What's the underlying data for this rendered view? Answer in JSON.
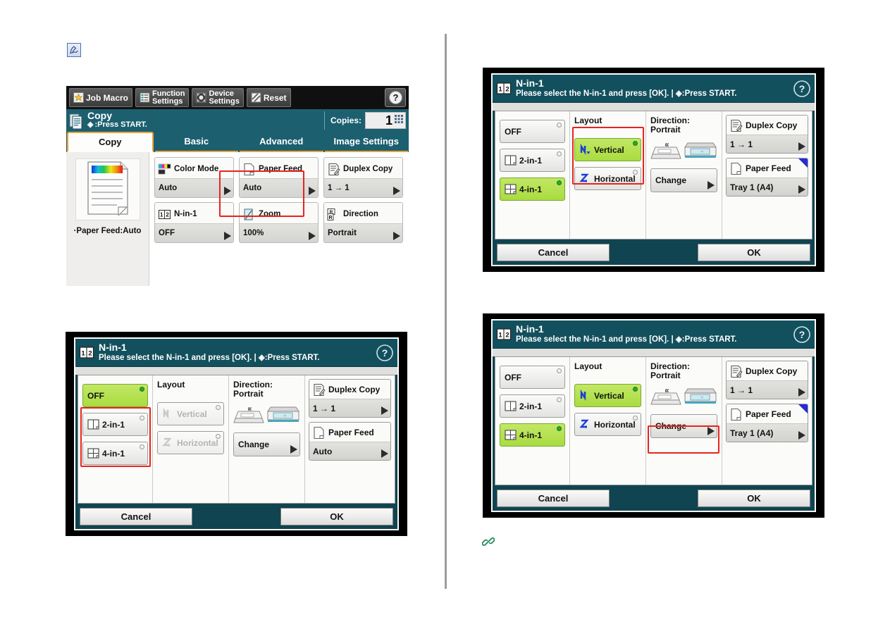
{
  "page": {
    "memo_icon": "memo-pen-icon",
    "link_icon": "link-chain-icon"
  },
  "console": {
    "toolbar": {
      "buttons": [
        {
          "label": "Job Macro",
          "icon": "star-macro-icon"
        },
        {
          "label_line1": "Function",
          "label_line2": "Settings",
          "icon": "list-settings-icon"
        },
        {
          "label_line1": "Device",
          "label_line2": "Settings",
          "icon": "device-settings-icon"
        },
        {
          "label": "Reset",
          "icon": "reset-slash-icon"
        }
      ],
      "help_icon": "help-question-icon"
    },
    "status": {
      "icon": "copy-document-icon",
      "title": "Copy",
      "subtitle": ":Press START.",
      "start_glyph": "◈",
      "copies_label": "Copies:",
      "copies_value": "1",
      "keypad_icon": "keypad-icon"
    },
    "tabs": [
      {
        "label": "Copy",
        "active": true
      },
      {
        "label": "Basic",
        "active": false
      },
      {
        "label": "Advanced",
        "active": false
      },
      {
        "label": "Image Settings",
        "active": false
      }
    ],
    "preview": {
      "icon": "color-page-preview-icon",
      "caption": "·Paper Feed:Auto"
    },
    "functions": [
      {
        "name": "Color Mode",
        "value": "Auto",
        "icon": "color-mode-icon",
        "highlighted": false
      },
      {
        "name": "Paper Feed",
        "value": "Auto",
        "icon": "paper-feed-icon",
        "highlighted": false
      },
      {
        "name": "Duplex Copy",
        "value": "1 → 1",
        "icon": "duplex-copy-icon",
        "highlighted": false
      },
      {
        "name": "N-in-1",
        "value": "OFF",
        "icon": "n-in-1-icon",
        "highlighted": true
      },
      {
        "name": "Zoom",
        "value": "100%",
        "icon": "zoom-icon",
        "highlighted": false
      },
      {
        "name": "Direction",
        "value": "Portrait",
        "icon": "direction-icon",
        "highlighted": false
      }
    ]
  },
  "dialog_common": {
    "icon": "n-in-1-icon",
    "title": "N-in-1",
    "instruction": "Please select the N-in-1 and press [OK]. | ◈:Press START.",
    "help_icon": "help-question-icon",
    "layout_heading": "Layout",
    "direction_heading_line1": "Direction:",
    "direction_heading_line2": "Portrait",
    "change_label": "Change",
    "cancel_label": "Cancel",
    "ok_label": "OK",
    "mode_options": [
      "OFF",
      "2-in-1",
      "4-in-1"
    ],
    "layout_options": [
      "Vertical",
      "Horizontal"
    ],
    "duplex": {
      "name": "Duplex Copy",
      "value": "1 → 1",
      "icon": "duplex-copy-icon"
    },
    "paper_feed_name": "Paper Feed",
    "paper_feed_icon": "paper-feed-icon",
    "scanner_icon_1": "adf-scanner-icon",
    "scanner_icon_2": "flatbed-scanner-icon"
  },
  "dialog_top_right": {
    "selected_mode": "4-in-1",
    "selected_layout": "Vertical",
    "layout_enabled": true,
    "paper_feed_value": "Tray 1 (A4)",
    "paper_feed_corner": true,
    "highlight": "layout-group"
  },
  "dialog_bottom_left": {
    "selected_mode": "OFF",
    "selected_layout": null,
    "layout_enabled": false,
    "paper_feed_value": "Auto",
    "paper_feed_corner": false,
    "highlight": "mode-2in1-4in1"
  },
  "dialog_bottom_right": {
    "selected_mode": "4-in-1",
    "selected_layout": "Vertical",
    "layout_enabled": true,
    "paper_feed_value": "Tray 1 (A4)",
    "paper_feed_corner": true,
    "highlight": "change-button"
  },
  "colors": {
    "teal_header": "#13505e",
    "teal_status": "#1c6070",
    "selected_green": "#b4e04d",
    "highlight_red": "#e8241c",
    "tab_accent": "#e8a33d",
    "blue_corner": "#2a2ad0"
  }
}
